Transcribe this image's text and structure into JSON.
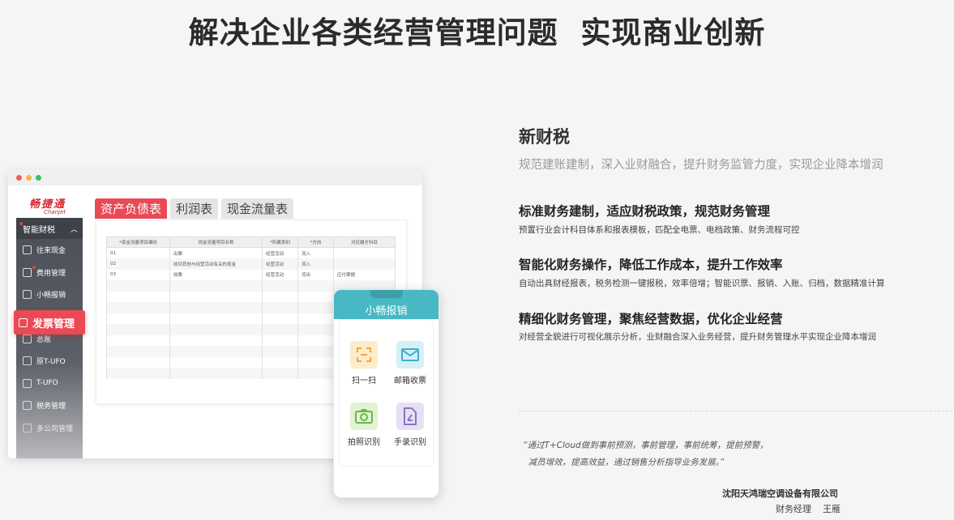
{
  "headline": "解决企业各类经营管理问题  实现商业创新",
  "app": {
    "logo": "畅捷通",
    "logo_en": "Chanjet",
    "sidebar": {
      "group_label": "智能财税",
      "items": [
        {
          "label": "往来现金"
        },
        {
          "label": "费用管理"
        },
        {
          "label": "小畅报销"
        },
        {
          "label": "总账"
        },
        {
          "label": "原T-UFO"
        },
        {
          "label": "T-UFO"
        },
        {
          "label": "税务管理"
        },
        {
          "label": "多公司管理"
        }
      ],
      "active_label": "发票管理"
    },
    "tabs": [
      "资产负债表",
      "利润表",
      "现金流量表"
    ],
    "table": {
      "headers": [
        "*现金流量项目编码",
        "现金流量项目名称",
        "*所属类别",
        "*方向",
        "对应缴方科目"
      ],
      "rows": [
        [
          "01",
          "出票",
          "经营活动",
          "流入",
          ""
        ],
        [
          "02",
          "收到其他与经营活动有关的现金",
          "经营活动",
          "流入",
          ""
        ],
        [
          "03",
          "收票",
          "经营活动",
          "流出",
          "应付票据"
        ]
      ]
    }
  },
  "mobile": {
    "title": "小畅报销",
    "features": [
      {
        "label": "扫一扫",
        "icon": "scan-icon"
      },
      {
        "label": "邮箱收票",
        "icon": "mail-icon"
      },
      {
        "label": "拍照识别",
        "icon": "camera-icon"
      },
      {
        "label": "手录识别",
        "icon": "edit-doc-icon"
      }
    ]
  },
  "section": {
    "title": "新财税",
    "subtitle": "规范建账建制，深入业财融合，提升财务监管力度，实现企业降本增润",
    "features": [
      {
        "title": "标准财务建制，适应财税政策，规范财务管理",
        "desc": "预置行业会计科目体系和报表模板，匹配全电票、电档政策、财务流程可控"
      },
      {
        "title": "智能化财务操作，降低工作成本，提升工作效率",
        "desc": "自动出具财经报表，税务检测一键报税，效率倍增；智能识票、报销、入账、归档，数据精准计算"
      },
      {
        "title": "精细化财务管理，聚焦经营数据，优化企业经营",
        "desc": "对经营全貌进行可视化展示分析，业财融合深入业务经营，提升财务管理水平实现企业降本增润"
      }
    ],
    "testimonial": {
      "quote": "“通过T+Cloud做到事前预测，事前管理，事前统筹，提前预警，\n  减员增效，提高效益，通过销售分析指导业务发展。”",
      "company": "沈阳天鸿瑞空调设备有限公司",
      "person": "财务经理    王雁"
    }
  },
  "colors": {
    "accent": "#e94a55",
    "teal": "#47b8c4",
    "sidebar": "#4a4e57"
  }
}
